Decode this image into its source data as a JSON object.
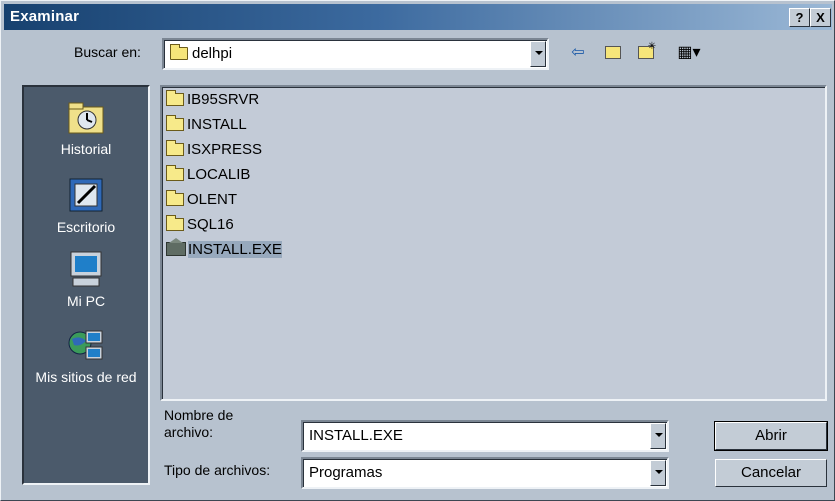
{
  "window": {
    "title": "Examinar"
  },
  "titlebar": {
    "help_label": "?",
    "close_label": "X"
  },
  "lookin": {
    "label": "Buscar en:",
    "value": "delhpi"
  },
  "toolbar": {
    "back_glyph": "⇦",
    "up_glyph": "🗈",
    "newfolder_glyph": "✳",
    "views_glyph": "▦▾"
  },
  "places": [
    {
      "label": "Historial",
      "icon": "history-icon"
    },
    {
      "label": "Escritorio",
      "icon": "desktop-icon"
    },
    {
      "label": "Mi PC",
      "icon": "computer-icon"
    },
    {
      "label": "Mis sitios de red",
      "icon": "network-icon"
    }
  ],
  "files": [
    {
      "name": "IB95SRVR",
      "type": "folder"
    },
    {
      "name": "INSTALL",
      "type": "folder"
    },
    {
      "name": "ISXPRESS",
      "type": "folder"
    },
    {
      "name": "LOCALIB",
      "type": "folder"
    },
    {
      "name": "OLENT",
      "type": "folder"
    },
    {
      "name": "SQL16",
      "type": "folder"
    },
    {
      "name": "INSTALL.EXE",
      "type": "exe",
      "selected": true
    }
  ],
  "filename": {
    "label_line1": "Nombre de",
    "label_line2": "archivo:",
    "value": "INSTALL.EXE"
  },
  "filetype": {
    "label": "Tipo de archivos:",
    "value": "Programas"
  },
  "buttons": {
    "open_label": "Abrir",
    "cancel_label": "Cancelar"
  },
  "colors": {
    "title_start": "#17416f",
    "title_end": "#9bb8d6",
    "dialog_bg": "#b7c2cf",
    "places_bg": "#4b5a6b"
  }
}
